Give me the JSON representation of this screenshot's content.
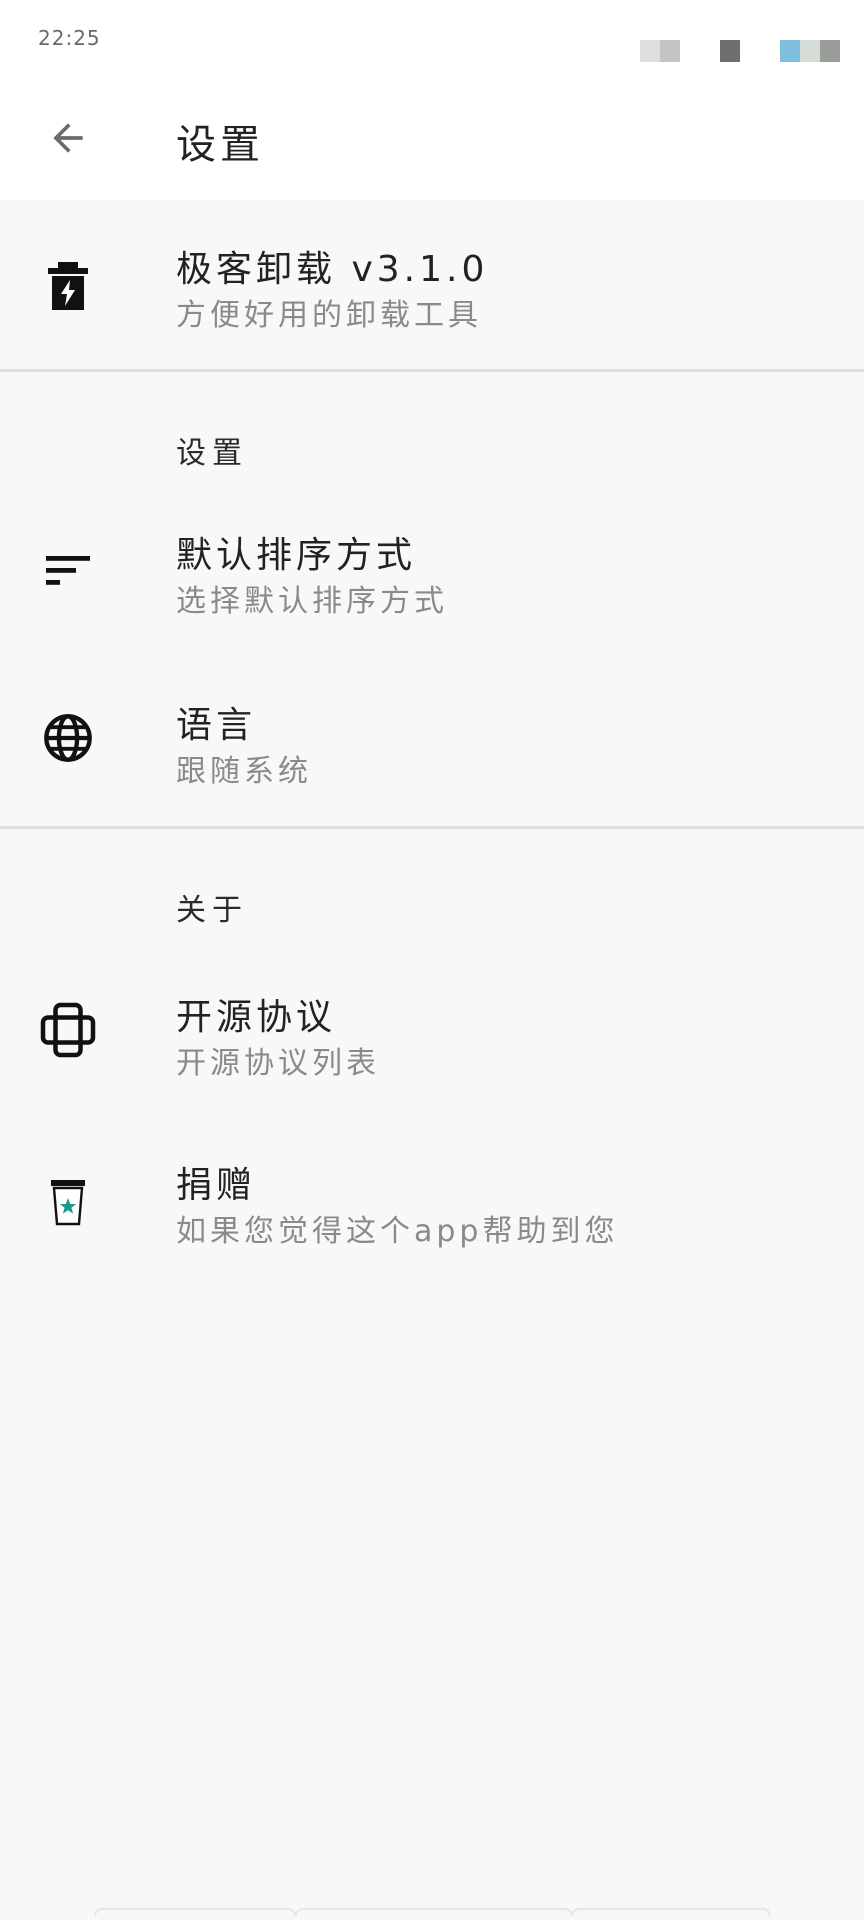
{
  "status_bar": {
    "time": "22:25"
  },
  "app_bar": {
    "title": "设置",
    "back_icon": "arrow-back-icon"
  },
  "header_item": {
    "title": "极客卸载 v3.1.0",
    "subtitle": "方便好用的卸载工具",
    "icon": "trash-bolt-icon"
  },
  "sections": [
    {
      "header": "设置",
      "items": [
        {
          "title": "默认排序方式",
          "subtitle": "选择默认排序方式",
          "icon": "sort-icon"
        },
        {
          "title": "语言",
          "subtitle": "跟随系统",
          "icon": "globe-icon"
        }
      ]
    },
    {
      "header": "关于",
      "items": [
        {
          "title": "开源协议",
          "subtitle": "开源协议列表",
          "icon": "license-icon"
        },
        {
          "title": "捐赠",
          "subtitle": "如果您觉得这个app帮助到您",
          "icon": "coffee-cup-icon"
        }
      ]
    }
  ],
  "colors": {
    "background": "#f8f8f8",
    "appbar": "#ffffff",
    "title_text": "#222222",
    "subtitle_text": "#8a8a8a",
    "divider": "#e0e0e0",
    "accent_star": "#1a9a8a"
  }
}
